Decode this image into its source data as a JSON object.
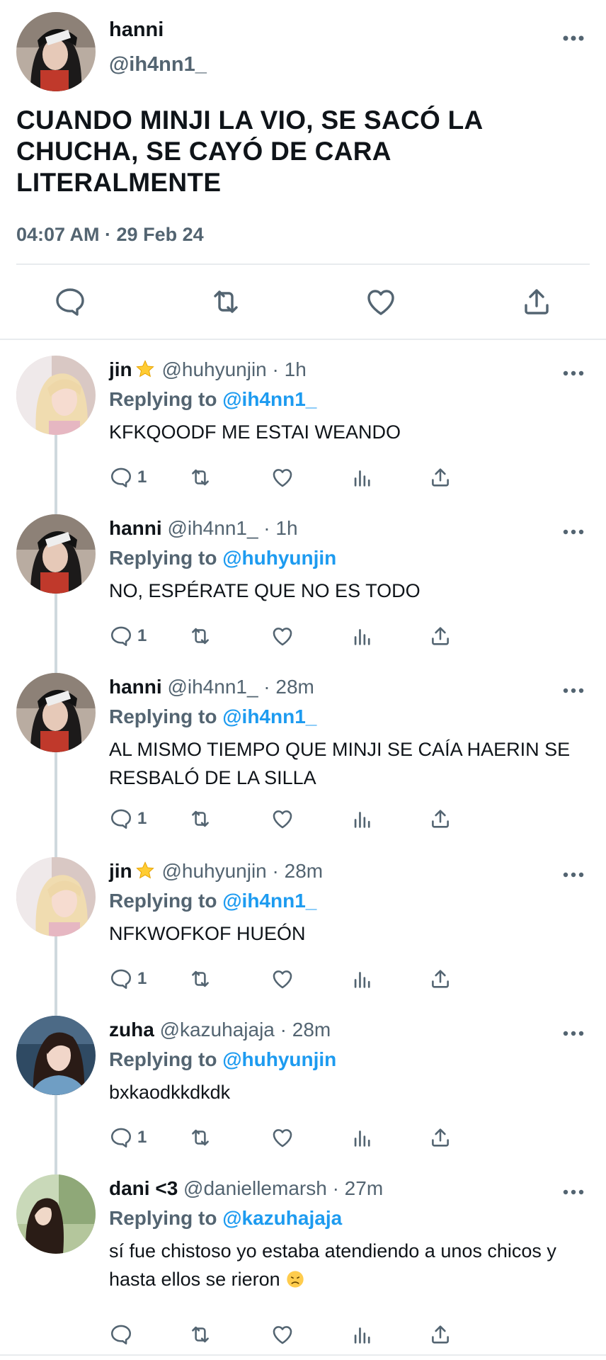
{
  "main_tweet": {
    "name": "hanni",
    "handle": "@ih4nn1_",
    "text": "CUANDO MINJI LA VIO, SE SACÓ LA CHUCHA, SE CAYÓ DE CARA LITERALMENTE",
    "timestamp": "04:07 AM · 29 Feb 24",
    "actions": [
      "reply-icon",
      "retweet-icon",
      "like-icon",
      "share-icon"
    ]
  },
  "replies": [
    {
      "name": "jin",
      "badge": "star-emoji",
      "meta": "@huhyunjin · 1h",
      "replying_prefix": "Replying to",
      "replying_to": "@ih4nn1_",
      "text": "KFKQOODF ME ESTAI WEANDO",
      "reply_count": "1"
    },
    {
      "name": "hanni",
      "meta": "@ih4nn1_ · 1h",
      "replying_prefix": "Replying to",
      "replying_to": "@huhyunjin",
      "text": "NO, ESPÉRATE QUE NO ES TODO",
      "reply_count": "1"
    },
    {
      "name": "hanni",
      "meta": "@ih4nn1_ · 28m",
      "replying_prefix": "Replying to",
      "replying_to": "@ih4nn1_",
      "text": "AL MISMO TIEMPO QUE MINJI SE CAÍA HAERIN SE RESBALÓ DE LA SILLA",
      "reply_count": "1"
    },
    {
      "name": "jin",
      "badge": "star-emoji",
      "meta": "@huhyunjin · 28m",
      "replying_prefix": "Replying to",
      "replying_to": "@ih4nn1_",
      "text": "NFKWOFKOF HUEÓN",
      "reply_count": "1"
    },
    {
      "name": "zuha",
      "meta": "@kazuhajaja · 28m",
      "replying_prefix": "Replying to",
      "replying_to": "@huhyunjin",
      "text": "bxkaodkkdkdk",
      "reply_count": "1"
    },
    {
      "name": "dani <3",
      "meta": "@daniellemarsh · 27m",
      "replying_prefix": "Replying to",
      "replying_to": "@kazuhajaja",
      "text": "sí fue chistoso yo estaba atendiendo a unos chicos y hasta ellos se rieron",
      "text_emoji": "disappointed-face-emoji",
      "reply_count": ""
    }
  ],
  "colors": {
    "text": "#0f1419",
    "muted": "#536471",
    "link": "#1d9bf0",
    "divider": "#e8ebee",
    "thread_line": "#cfd9de"
  }
}
